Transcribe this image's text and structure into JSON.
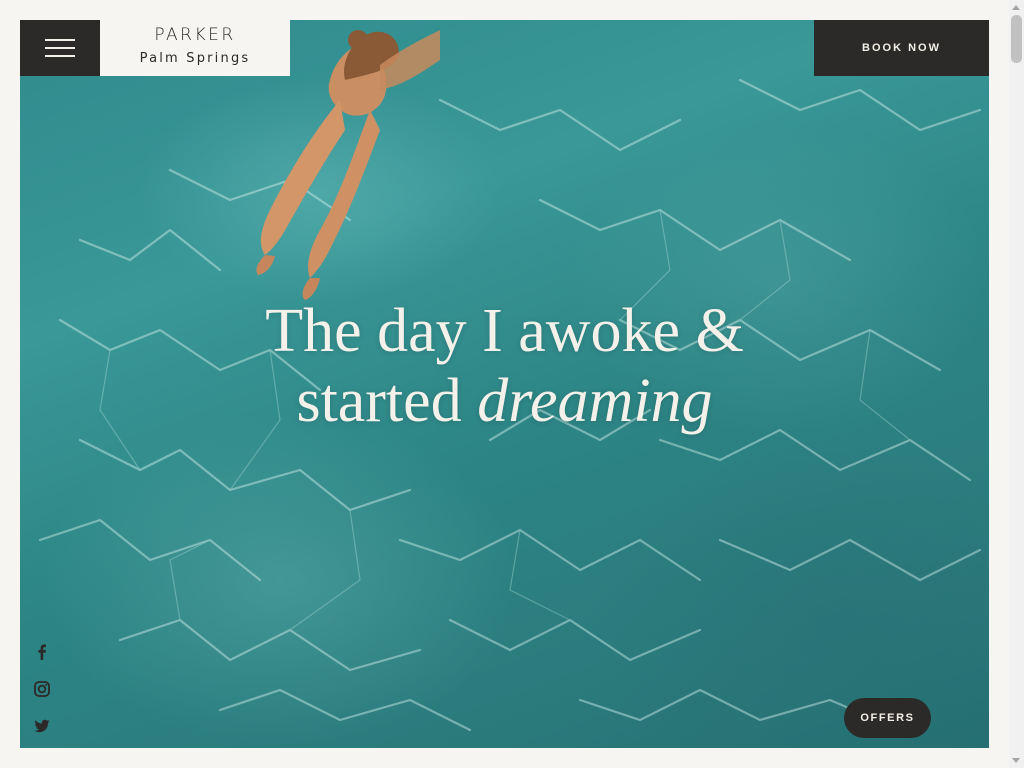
{
  "header": {
    "menu_icon": "hamburger-icon",
    "logo_line1": "PARKER",
    "logo_line2": "Palm Springs",
    "book_label": "BOOK NOW"
  },
  "hero": {
    "headline_line1": "The day I awoke &",
    "headline_line2_plain": "started",
    "headline_line2_italic": "dreaming",
    "background": "pool-water-swimmer-photo"
  },
  "social": [
    {
      "icon": "facebook-icon"
    },
    {
      "icon": "instagram-icon"
    },
    {
      "icon": "twitter-icon"
    }
  ],
  "offers_label": "OFFERS",
  "colors": {
    "dark": "#2b2a28",
    "cream": "#f7f5f1",
    "water": "#2f8a8c"
  }
}
